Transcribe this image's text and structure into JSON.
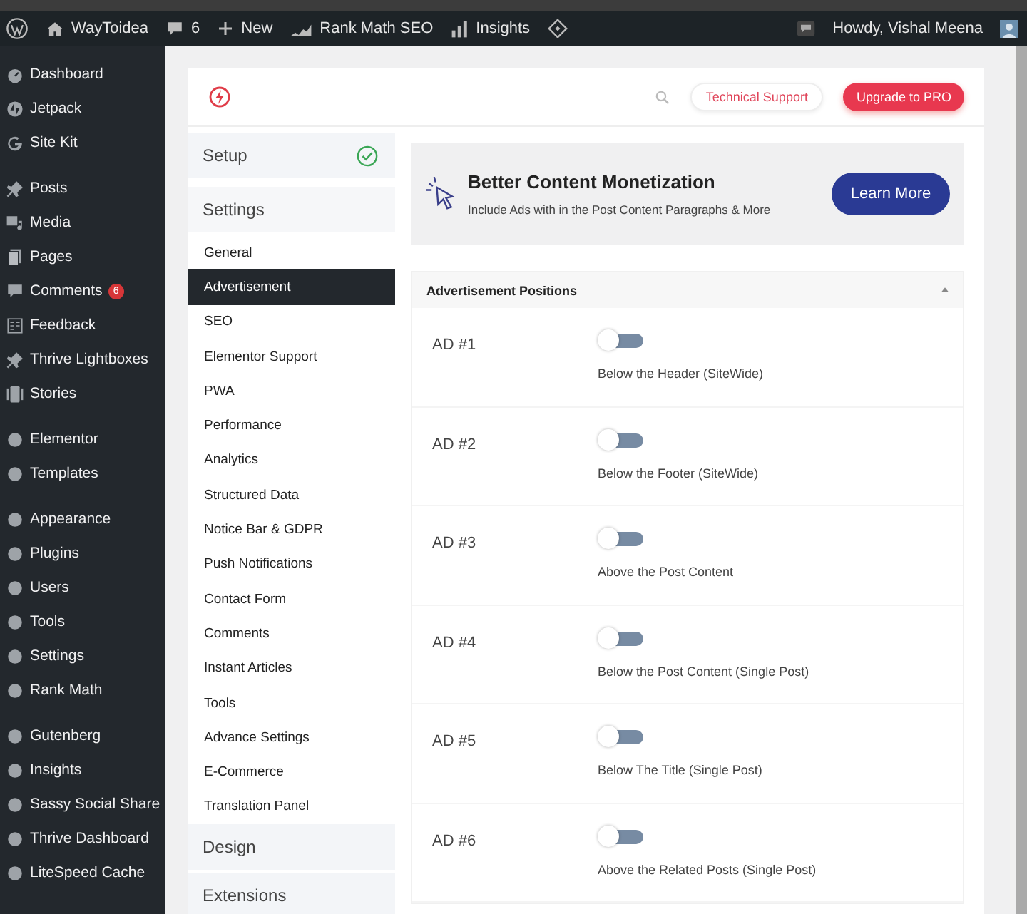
{
  "admin_bar": {
    "site": "WayToidea",
    "comments": "6",
    "new": "New",
    "seo": "Rank Math SEO",
    "insights": "Insights",
    "greeting": "Howdy, Vishal Meena"
  },
  "sidebar": {
    "groups": [
      [
        {
          "label": "Dashboard"
        },
        {
          "label": "Jetpack"
        },
        {
          "label": "Site Kit"
        }
      ],
      [
        {
          "label": "Posts"
        },
        {
          "label": "Media"
        },
        {
          "label": "Pages"
        },
        {
          "label": "Comments",
          "badge": "6"
        },
        {
          "label": "Feedback"
        },
        {
          "label": "Thrive Lightboxes"
        },
        {
          "label": "Stories"
        }
      ],
      [
        {
          "label": "Elementor"
        },
        {
          "label": "Templates"
        }
      ],
      [
        {
          "label": "Appearance"
        },
        {
          "label": "Plugins"
        },
        {
          "label": "Users"
        },
        {
          "label": "Tools"
        },
        {
          "label": "Settings"
        },
        {
          "label": "Rank Math"
        }
      ],
      [
        {
          "label": "Gutenberg"
        },
        {
          "label": "Insights"
        },
        {
          "label": "Sassy Social Share"
        },
        {
          "label": "Thrive Dashboard"
        },
        {
          "label": "LiteSpeed Cache"
        }
      ]
    ]
  },
  "header": {
    "support": "Technical Support",
    "upgrade": "Upgrade to PRO"
  },
  "nav": {
    "sections": [
      {
        "label": "Setup",
        "completed": true
      },
      {
        "label": "Settings",
        "completed": false,
        "items": [
          {
            "label": "General",
            "selected": false
          },
          {
            "label": "Advertisement",
            "selected": true
          },
          {
            "label": "SEO",
            "selected": false
          },
          {
            "label": "Elementor Support",
            "selected": false
          },
          {
            "label": "PWA",
            "selected": false
          },
          {
            "label": "Performance",
            "selected": false
          },
          {
            "label": "Analytics",
            "selected": false
          },
          {
            "label": "Structured Data",
            "selected": false
          },
          {
            "label": "Notice Bar & GDPR",
            "selected": false
          },
          {
            "label": "Push Notifications",
            "selected": false
          },
          {
            "label": "Contact Form",
            "selected": false
          },
          {
            "label": "Comments",
            "selected": false
          },
          {
            "label": "Instant Articles",
            "selected": false
          },
          {
            "label": "Tools",
            "selected": false
          },
          {
            "label": "Advance Settings",
            "selected": false
          },
          {
            "label": "E-Commerce",
            "selected": false
          },
          {
            "label": "Translation Panel",
            "selected": false
          }
        ]
      },
      {
        "label": "Design",
        "completed": false
      },
      {
        "label": "Extensions",
        "completed": false
      }
    ]
  },
  "banner": {
    "title": "Better Content Monetization",
    "text": "Include Ads with in the Post Content Paragraphs & More",
    "button": "Learn More"
  },
  "panel": {
    "title": "Advertisement Positions",
    "expanded": true,
    "rows": [
      {
        "label": "AD #1",
        "on": false,
        "description": "Below the Header (SiteWide)"
      },
      {
        "label": "AD #2",
        "on": false,
        "description": "Below the Footer (SiteWide)"
      },
      {
        "label": "AD #3",
        "on": false,
        "description": "Above the Post Content"
      },
      {
        "label": "AD #4",
        "on": false,
        "description": "Below the Post Content (Single Post)"
      },
      {
        "label": "AD #5",
        "on": false,
        "description": "Below The Title (Single Post)"
      },
      {
        "label": "AD #6",
        "on": false,
        "description": "Above the Related Posts (Single Post)"
      }
    ]
  }
}
